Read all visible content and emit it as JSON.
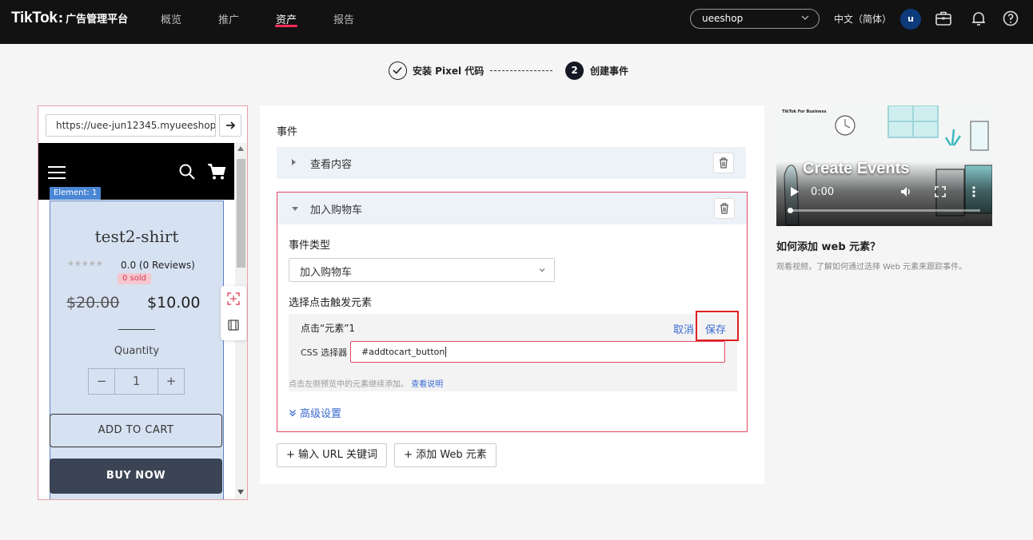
{
  "brand": {
    "logo": "TikTok",
    "logo_sep": ":",
    "subtitle": "广告管理平台"
  },
  "nav": {
    "items": [
      "概览",
      "推广",
      "资产",
      "报告"
    ],
    "active": "资产"
  },
  "header": {
    "account": "ueeshop",
    "language": "中文（简体）",
    "avatar_initial": "u"
  },
  "stepper": {
    "step1": "安装 Pixel 代码",
    "step2_number": "2",
    "step2": "创建事件"
  },
  "preview": {
    "url": "https://uee-jun12345.myueeshop.com",
    "element_tag": "Element: 1",
    "product": {
      "title": "test2-shirt",
      "stars": "★★★★★",
      "rating": "0.0",
      "reviews": "(0 Reviews)",
      "sold": "0 sold",
      "old_price": "$20.00",
      "new_price": "$10.00",
      "quantity_label": "Quantity",
      "quantity_minus": "−",
      "quantity_value": "1",
      "quantity_plus": "+",
      "add_to_cart": "ADD TO CART",
      "buy_now": "BUY NOW"
    }
  },
  "events": {
    "section_title": "事件",
    "collapsed_event": "查看内容",
    "expanded_event": {
      "name": "加入购物车",
      "type_label": "事件类型",
      "type_value": "加入购物车",
      "trigger_label": "选择点击触发元素",
      "click_title": "点击“元素”1",
      "cancel": "取消",
      "save": "保存",
      "css_label": "CSS 选择器",
      "css_value": "#addtocart_button",
      "hint": "点击左侧预览中的元素继续添加。",
      "hint_link": "查看说明",
      "advanced": "高级设置"
    },
    "add_url_button": "+ 输入 URL 关键词",
    "add_web_button": "+ 添加 Web 元素"
  },
  "video": {
    "brand": "TikTok For Business",
    "title": "Create Events",
    "time": "0:00",
    "progress": 0
  },
  "help": {
    "title": "如何添加 web 元素？",
    "desc": "观看视频，了解如何通过选择 Web 元素来跟踪事件。"
  },
  "colors": {
    "accent": "#fe2c55",
    "link": "#3a6bd1",
    "highlight_border": "#e04a64",
    "save_box": "#e02020"
  }
}
